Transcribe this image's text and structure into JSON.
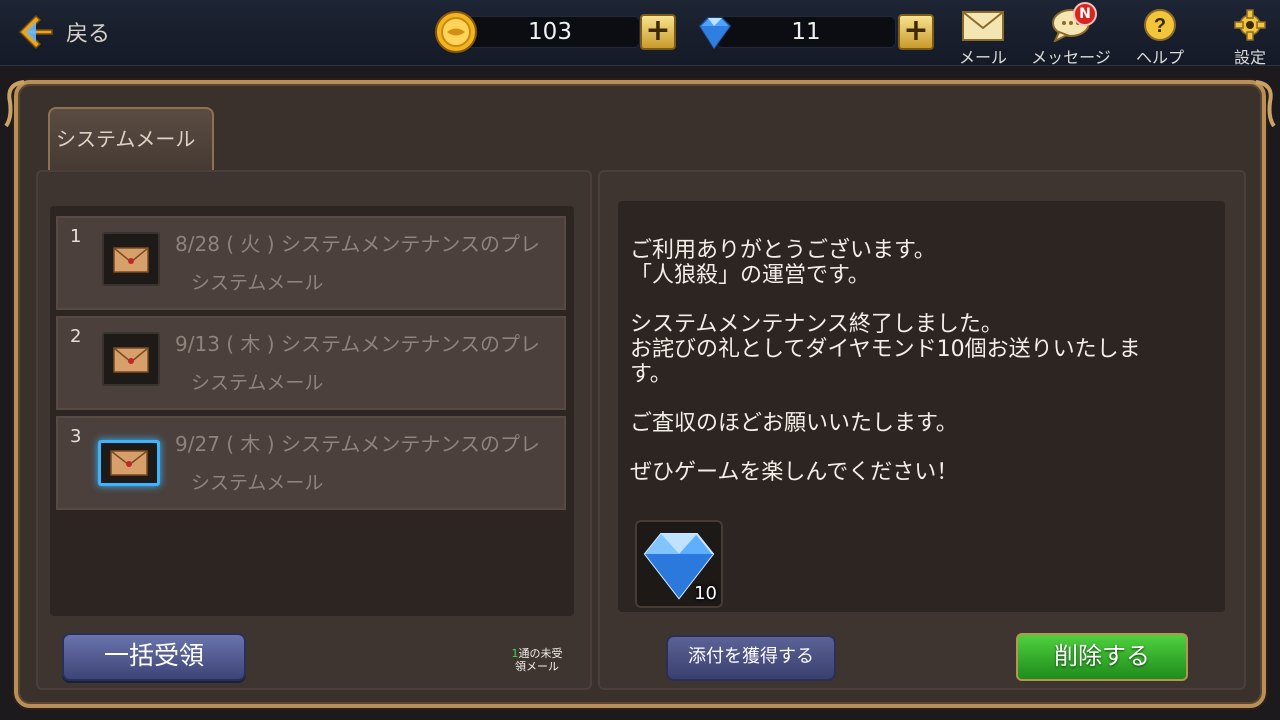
{
  "topbar": {
    "back_label": "戻る",
    "coins": "103",
    "gems": "11",
    "mail_label": "メール",
    "message_label": "メッセージ",
    "message_badge": "N",
    "help_label": "ヘルプ",
    "settings_label": "設定"
  },
  "tab": {
    "label": "システムメール"
  },
  "mails": [
    {
      "num": "1",
      "title": "8/28 ( 火 ) システムメンテナンスのプレ",
      "sender": "システムメール"
    },
    {
      "num": "2",
      "title": "9/13 ( 木 ) システムメンテナンスのプレ",
      "sender": "システムメール"
    },
    {
      "num": "3",
      "title": "9/27 ( 木 ) システムメンテナンスのプレ",
      "sender": "システムメール"
    }
  ],
  "bulk_label": "一括受領",
  "unread": {
    "count": "1",
    "text1": "通の未受",
    "text2": "領メール"
  },
  "message": {
    "line1": "ご利用ありがとうございます。",
    "line2": "「人狼殺」の運営です。",
    "line3": "システムメンテナンス終了しました。",
    "line4": "お詫びの礼としてダイヤモンド10個お送りいたしま",
    "line5": "す。",
    "line6": "ご査収のほどお願いいたします。",
    "line7": "ぜひゲームを楽しんでください！"
  },
  "attachment": {
    "icon": "diamond-icon",
    "count": "10"
  },
  "get_attach_label": "添付を獲得する",
  "delete_label": "削除する"
}
